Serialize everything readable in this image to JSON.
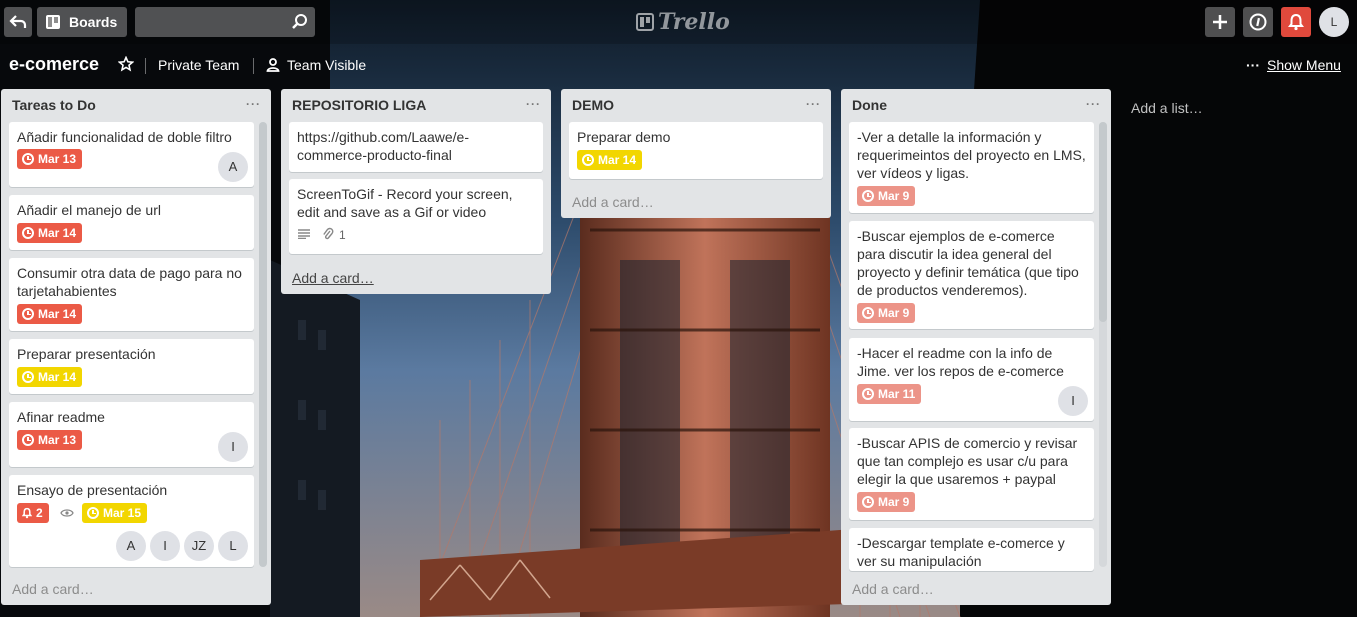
{
  "header": {
    "boards_label": "Boards",
    "search": {
      "value": "",
      "placeholder": ""
    },
    "logo_text": "Trello",
    "user_initial": "L"
  },
  "board": {
    "title": "e-comerce",
    "team": "Private Team",
    "visibility": "Team Visible",
    "show_menu": "Show Menu",
    "add_list": "Add a list…"
  },
  "lists": [
    {
      "title": "Tareas to Do",
      "add_card": "Add a card…",
      "cards": [
        {
          "text": "Añadir funcionalidad de doble filtro",
          "due": "Mar 13",
          "members": [
            "A"
          ]
        },
        {
          "text": "Añadir el manejo de url",
          "due": "Mar 14"
        },
        {
          "text": "Consumir otra data de pago para no tarjetahabientes",
          "due": "Mar 14"
        },
        {
          "text": "Preparar presentación",
          "due": "Mar 14"
        },
        {
          "text": "Afinar readme",
          "due": "Mar 13",
          "members": [
            "I"
          ]
        },
        {
          "text": "Ensayo de presentación",
          "notifications": "2",
          "due": "Mar 15",
          "members": [
            "A",
            "I",
            "JZ",
            "L"
          ]
        }
      ]
    },
    {
      "title": "REPOSITORIO LIGA",
      "add_card": "Add a card…",
      "cards": [
        {
          "text": "https://github.com/Laawe/e-commerce-producto-final"
        },
        {
          "text": "ScreenToGif - Record your screen, edit and save as a Gif or video",
          "attachments": "1"
        }
      ]
    },
    {
      "title": "DEMO",
      "add_card": "Add a card…",
      "cards": [
        {
          "text": "Preparar demo",
          "due": "Mar 14"
        }
      ]
    },
    {
      "title": "Done",
      "add_card": "Add a card…",
      "cards": [
        {
          "text": "-Ver a detalle la información y requerimeintos del proyecto en LMS, ver vídeos y ligas.",
          "due": "Mar 9"
        },
        {
          "text": "-Buscar ejemplos de e-comerce para discutir la idea general del proyecto y definir temática (que tipo de productos venderemos).",
          "due": "Mar 9"
        },
        {
          "text": "-Hacer el readme con la info de Jime. ver los repos de e-comerce",
          "due": "Mar 11",
          "members": [
            "I"
          ]
        },
        {
          "text": "-Buscar APIS de comercio y revisar que tan complejo es usar c/u para elegir la que usaremos + paypal",
          "due": "Mar 9"
        },
        {
          "text": "-Descargar template e-comerce y ver su manipulación"
        }
      ]
    }
  ],
  "colors": {
    "due_overdue": "#eb5a46",
    "due_soon": "#f2d600",
    "due_complete": "#ec9488",
    "notification": "#e0493c",
    "list_bg": "#e2e4e6"
  },
  "icons": [
    "back-arrow-icon",
    "boards-icon",
    "search-icon",
    "trello-logo-icon",
    "plus-icon",
    "info-icon",
    "bell-icon",
    "star-icon",
    "team-icon",
    "more-icon",
    "clock-icon",
    "eye-icon",
    "description-icon",
    "paperclip-icon"
  ]
}
